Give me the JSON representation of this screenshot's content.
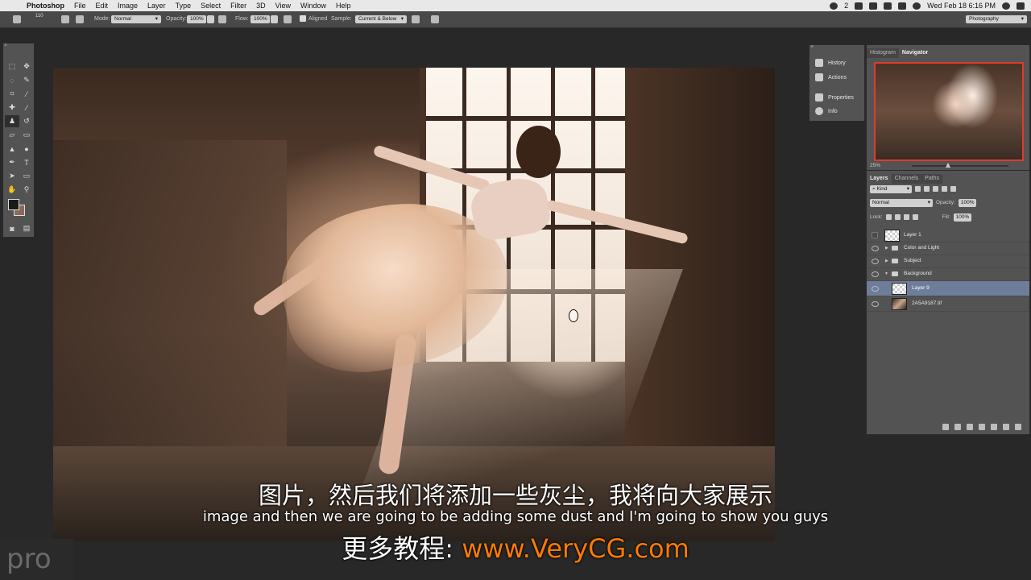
{
  "menubar": {
    "app": "Photoshop",
    "items": [
      "File",
      "Edit",
      "Image",
      "Layer",
      "Type",
      "Select",
      "Filter",
      "3D",
      "View",
      "Window",
      "Help"
    ],
    "clock": "Wed Feb 18  6:16 PM",
    "badge": "2"
  },
  "options_bar": {
    "brush_size": "110",
    "mode_label": "Mode:",
    "mode_value": "Normal",
    "opacity_label": "Opacity:",
    "opacity_value": "100%",
    "flow_label": "Flow:",
    "flow_value": "100%",
    "aligned_label": "Aligned",
    "sample_label": "Sample:",
    "sample_value": "Current & Below",
    "workspace_value": "Photography"
  },
  "dock": {
    "items": [
      {
        "label": "History",
        "icon": "history-icon"
      },
      {
        "label": "Actions",
        "icon": "play-icon"
      },
      {
        "label": "Properties",
        "icon": "properties-icon"
      },
      {
        "label": "Info",
        "icon": "info-icon"
      }
    ]
  },
  "navigator_panel": {
    "tabs": [
      "Histogram",
      "Navigator"
    ],
    "active_tab": "Navigator",
    "zoom": "25%"
  },
  "layers_panel": {
    "tabs": [
      "Layers",
      "Channels",
      "Paths"
    ],
    "active_tab": "Layers",
    "filter_value": "Kind",
    "blend_mode": "Normal",
    "opacity_label": "Opacity:",
    "opacity_value": "100%",
    "lock_label": "Lock:",
    "fill_label": "Fill:",
    "fill_value": "100%",
    "layers": [
      {
        "name": "Layer 1",
        "type": "layer",
        "visible": false
      },
      {
        "name": "Color and Light",
        "type": "group",
        "visible": true
      },
      {
        "name": "Subject",
        "type": "group",
        "visible": true
      },
      {
        "name": "Background",
        "type": "group-open",
        "visible": true
      },
      {
        "name": "Layer 9",
        "type": "layer",
        "visible": true,
        "selected": true
      },
      {
        "name": "2A5A9187.tif",
        "type": "photo",
        "visible": true
      }
    ]
  },
  "subtitles": {
    "chinese": "图片，然后我们将添加一些灰尘，我将向大家展示",
    "english": "image and then we are going to be adding some dust and I'm going to show you guys",
    "ad_prefix": "更多教程: ",
    "ad_url": "www.VeryCG.com"
  },
  "watermark": "pro"
}
